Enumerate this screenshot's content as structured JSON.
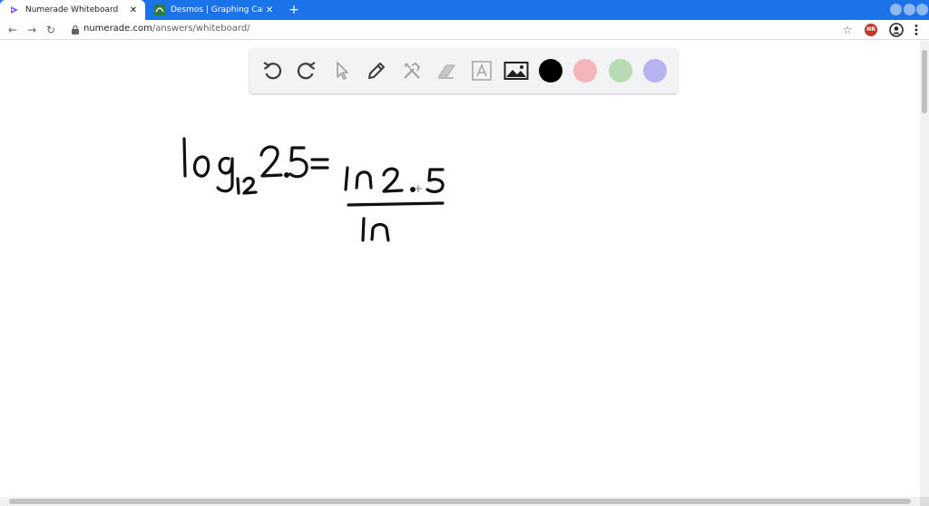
{
  "browser": {
    "tabs": [
      {
        "title": "Numerade Whiteboard",
        "active": true,
        "close": "✕"
      },
      {
        "title": "Desmos | Graphing Calculator",
        "active": false,
        "close": "✕"
      }
    ],
    "new_tab": "+",
    "address": {
      "host": "numerade.com",
      "path": "/answers/whiteboard/"
    },
    "back": "←",
    "forward": "→",
    "reload": "↻",
    "star": "☆",
    "extension_badge": "NR"
  },
  "whiteboard": {
    "tools": [
      {
        "name": "undo-icon"
      },
      {
        "name": "redo-icon"
      },
      {
        "name": "pointer-icon"
      },
      {
        "name": "pencil-icon"
      },
      {
        "name": "tools-icon"
      },
      {
        "name": "eraser-icon"
      },
      {
        "name": "text-icon"
      },
      {
        "name": "image-icon"
      }
    ],
    "colors": [
      "#000000",
      "#f4b6b8",
      "#b7dcb4",
      "#b6b3ee"
    ],
    "handwriting": {
      "lhs_base": "log",
      "lhs_subscript": "12",
      "lhs_arg": "2.5",
      "equals": "=",
      "numerator": "ln 2.5",
      "denominator": "ln"
    }
  }
}
